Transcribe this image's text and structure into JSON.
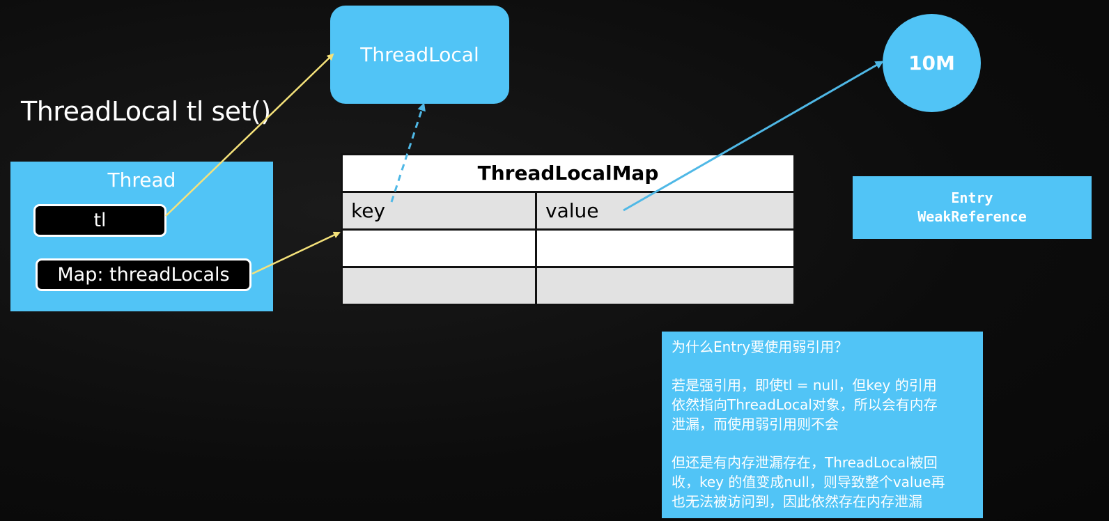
{
  "heading": "ThreadLocal tl set()",
  "threadlocal_node": {
    "label": "ThreadLocal"
  },
  "value_node": {
    "label": "10M"
  },
  "thread_node": {
    "label": "Thread",
    "field_tl": "tl",
    "field_map": "Map: threadLocals"
  },
  "map_table": {
    "title": "ThreadLocalMap",
    "col_key": "key",
    "col_value": "value",
    "rows": [
      [
        "",
        ""
      ],
      [
        "",
        ""
      ]
    ]
  },
  "entry_node": {
    "line1": "Entry",
    "line2": "WeakReference"
  },
  "note": {
    "question": "为什么Entry要使用弱引用？",
    "para1_line1": "若是强引用，即使tl = null，但key 的引用",
    "para1_line2": "依然指向ThreadLocal对象，所以会有内存",
    "para1_line3": "泄漏，而使用弱引用则不会",
    "para2_line1": "但还是有内存泄漏存在，ThreadLocal被回",
    "para2_line2": "收，key 的值变成null，则导致整个value再",
    "para2_line3": "也无法被访问到，因此依然存在内存泄漏"
  },
  "colors": {
    "node_blue": "#51c4f6",
    "arrow_yellow": "#f5e27a",
    "arrow_blue": "#4fb8e6",
    "background": "#0d0d0d"
  }
}
